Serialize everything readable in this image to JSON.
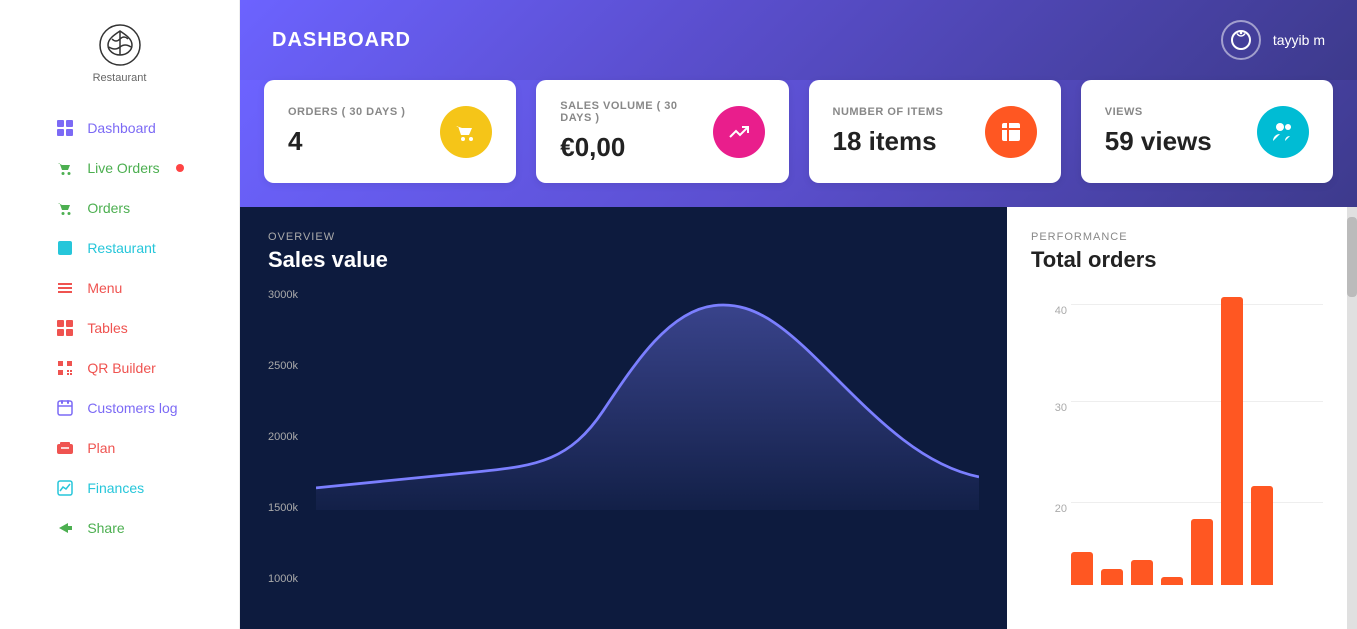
{
  "sidebar": {
    "logo_text": "Restaurant",
    "items": [
      {
        "id": "dashboard",
        "label": "Dashboard",
        "icon": "▣",
        "class": "nav-dashboard"
      },
      {
        "id": "liveorders",
        "label": "Live Orders",
        "icon": "🛍",
        "class": "nav-liveorders",
        "dot": true
      },
      {
        "id": "orders",
        "label": "Orders",
        "icon": "🛒",
        "class": "nav-orders"
      },
      {
        "id": "restaurant",
        "label": "Restaurant",
        "icon": "🏪",
        "class": "nav-restaurant"
      },
      {
        "id": "menu",
        "label": "Menu",
        "icon": "☰",
        "class": "nav-menu"
      },
      {
        "id": "tables",
        "label": "Tables",
        "icon": "⊞",
        "class": "nav-tables"
      },
      {
        "id": "qr",
        "label": "QR Builder",
        "icon": "📱",
        "class": "nav-qr"
      },
      {
        "id": "customers",
        "label": "Customers log",
        "icon": "📅",
        "class": "nav-customers"
      },
      {
        "id": "plan",
        "label": "Plan",
        "icon": "💳",
        "class": "nav-plan"
      },
      {
        "id": "finances",
        "label": "Finances",
        "icon": "📊",
        "class": "nav-finances"
      },
      {
        "id": "share",
        "label": "Share",
        "icon": "➤",
        "class": "nav-share"
      }
    ]
  },
  "header": {
    "title": "DASHBOARD",
    "user_name": "tayyib m",
    "user_icon": "⏻"
  },
  "stats": [
    {
      "id": "orders",
      "label": "ORDERS ( 30 DAYS )",
      "value": "4",
      "icon_class": "ic-yellow",
      "icon": "🛒"
    },
    {
      "id": "sales",
      "label": "SALES VOLUME ( 30 DAYS )",
      "value": "€0,00",
      "icon_class": "ic-pink",
      "icon": "📈"
    },
    {
      "id": "items",
      "label": "NUMBER OF ITEMS",
      "value": "18 items",
      "icon_class": "ic-orange",
      "icon": "📁"
    },
    {
      "id": "views",
      "label": "VIEWS",
      "value": "59 views",
      "icon_class": "ic-cyan",
      "icon": "👥"
    }
  ],
  "overview": {
    "section_label": "OVERVIEW",
    "title": "Sales value",
    "y_labels": [
      "3000k",
      "2500k",
      "2000k",
      "1500k",
      "1000k"
    ]
  },
  "performance": {
    "section_label": "PERFORMANCE",
    "title": "Total orders",
    "y_labels": [
      "40",
      "30",
      "20"
    ],
    "bars": [
      4,
      2,
      3,
      1,
      8,
      35,
      12
    ]
  }
}
